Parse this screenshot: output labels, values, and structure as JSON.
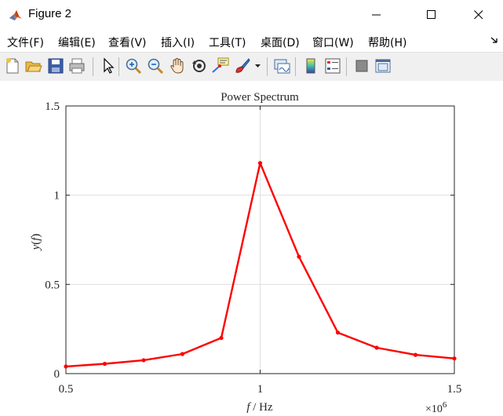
{
  "window": {
    "title": "Figure 2",
    "minimize_glyph": "—",
    "maximize_glyph": "☐",
    "close_glyph": "✕"
  },
  "menu": {
    "items": [
      {
        "label": "文件(F)"
      },
      {
        "label": "编辑(E)"
      },
      {
        "label": "查看(V)"
      },
      {
        "label": "插入(I)"
      },
      {
        "label": "工具(T)"
      },
      {
        "label": "桌面(D)"
      },
      {
        "label": "窗口(W)"
      },
      {
        "label": "帮助(H)"
      }
    ]
  },
  "toolbar": {
    "buttons": [
      "new-figure-icon",
      "open-file-icon",
      "save-icon",
      "print-icon",
      "pointer-icon",
      "zoom-in-icon",
      "zoom-out-icon",
      "pan-hand-icon",
      "rotate-3d-icon",
      "data-cursor-icon",
      "brush-icon",
      "brush-dropdown-icon",
      "link-plot-icon",
      "colorbar-icon",
      "legend-icon",
      "hide-plot-tools-icon",
      "show-plot-tools-icon"
    ]
  },
  "colors": {
    "line": "#ff0000",
    "grid": "#dfdfdf",
    "axis": "#262626",
    "toolbar_bg": "#f0f0f0"
  },
  "chart_data": {
    "type": "line",
    "title": "Power Spectrum",
    "xlabel_var": "f",
    "xlabel_unit": " / Hz",
    "ylabel_var": "y",
    "ylabel_arg": "f",
    "xlim": [
      0.5,
      1.5
    ],
    "ylim": [
      0,
      1.5
    ],
    "x_ticks": [
      "0.5",
      "1",
      "1.5"
    ],
    "y_ticks": [
      "0",
      "0.5",
      "1",
      "1.5"
    ],
    "x_exponent_base": "×10",
    "x_exponent_power": "6",
    "grid": true,
    "series": [
      {
        "color": "#ff0000",
        "x": [
          0.5,
          0.6,
          0.7,
          0.8,
          0.9,
          1.0,
          1.1,
          1.2,
          1.3,
          1.4,
          1.5
        ],
        "y": [
          0.04,
          0.055,
          0.075,
          0.11,
          0.2,
          1.18,
          0.655,
          0.23,
          0.145,
          0.105,
          0.085
        ]
      }
    ]
  }
}
